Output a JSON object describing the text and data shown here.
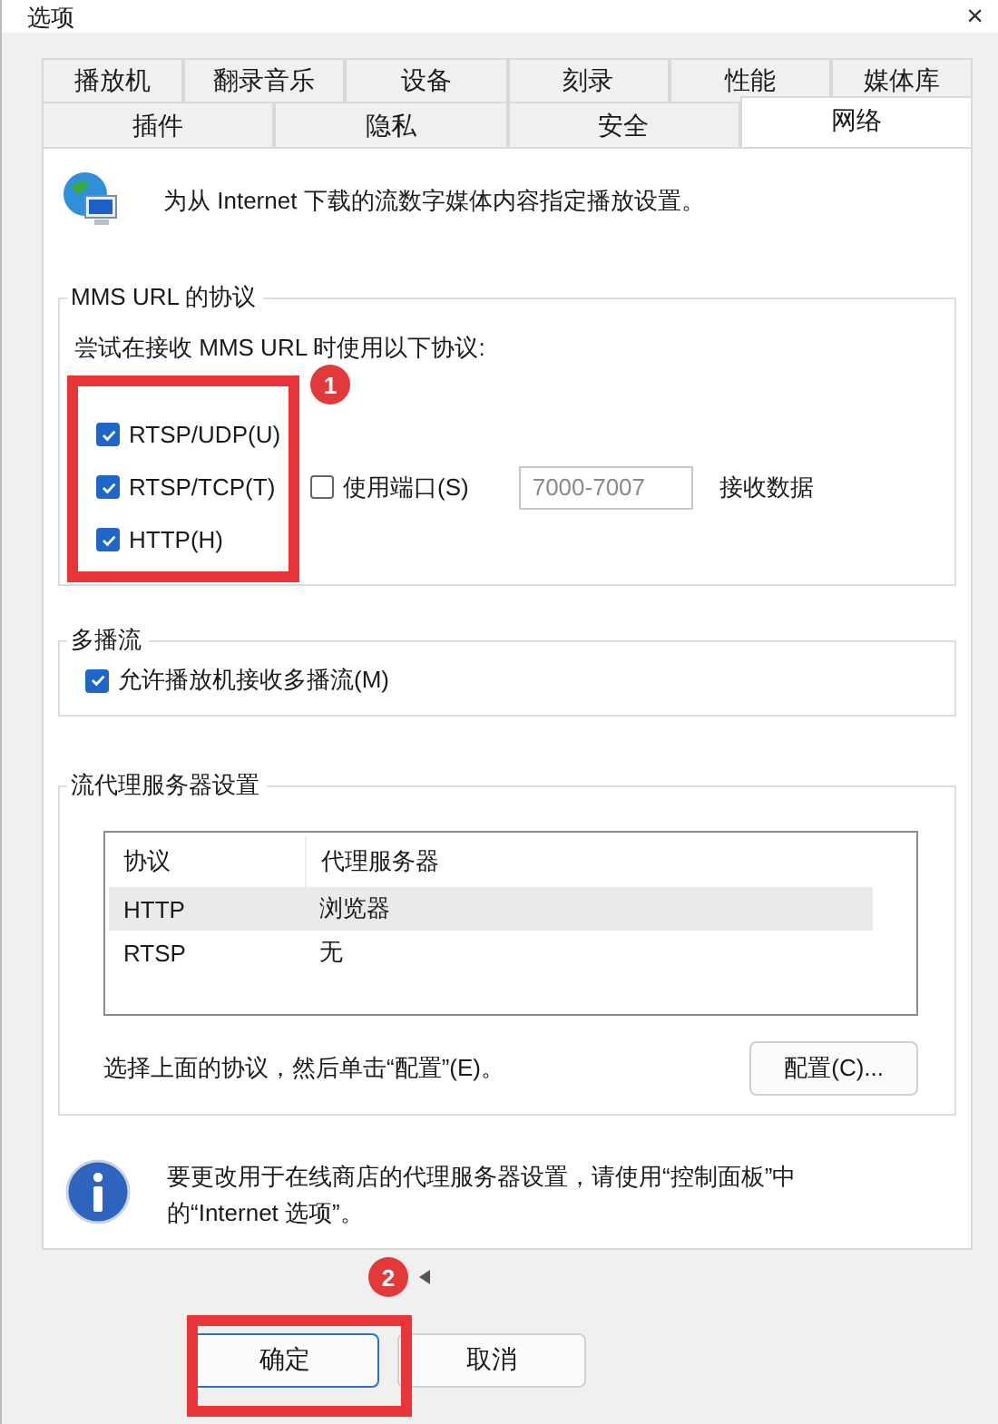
{
  "window": {
    "title": "选项",
    "close": "×"
  },
  "tabs_row_1": [
    {
      "label": "播放机",
      "selected": false
    },
    {
      "label": "翻录音乐",
      "selected": false
    },
    {
      "label": "设备",
      "selected": false
    },
    {
      "label": "刻录",
      "selected": false
    },
    {
      "label": "性能",
      "selected": false
    },
    {
      "label": "媒体库",
      "selected": false
    }
  ],
  "tabs_row_2": [
    {
      "label": "插件",
      "selected": false
    },
    {
      "label": "隐私",
      "selected": false
    },
    {
      "label": "安全",
      "selected": false
    },
    {
      "label": "网络",
      "selected": true
    }
  ],
  "intro": "为从 Internet 下载的流数字媒体内容指定播放设置。",
  "mms": {
    "title": "MMS URL 的协议",
    "instruction": "尝试在接收 MMS URL 时使用以下协议:",
    "protocols": [
      {
        "label": "RTSP/UDP(U)",
        "checked": true
      },
      {
        "label": "RTSP/TCP(T)",
        "checked": true
      },
      {
        "label": "HTTP(H)",
        "checked": true
      }
    ],
    "use_port": {
      "label": "使用端口(S)",
      "checked": false
    },
    "port_range": {
      "value": "7000-7007",
      "disabled": true
    },
    "port_suffix": "接收数据"
  },
  "multicast": {
    "title": "多播流",
    "option": {
      "label": "允许播放机接收多播流(M)",
      "checked": true
    }
  },
  "proxy": {
    "title": "流代理服务器设置",
    "columns": [
      "协议",
      "代理服务器"
    ],
    "rows": [
      {
        "protocol": "HTTP",
        "proxy": "浏览器",
        "selected": true
      },
      {
        "protocol": "RTSP",
        "proxy": "无",
        "selected": false
      }
    ],
    "hint": "选择上面的协议，然后单击“配置”(E)。",
    "configure_button": "配置(C)..."
  },
  "info": "要更改用于在线商店的代理服务器设置，请使用“控制面板”中的“Internet 选项”。",
  "buttons": [
    {
      "label": "确定",
      "default": true
    },
    {
      "label": "取消",
      "default": false
    }
  ],
  "annotations": [
    {
      "number": "1"
    },
    {
      "number": "2"
    }
  ]
}
